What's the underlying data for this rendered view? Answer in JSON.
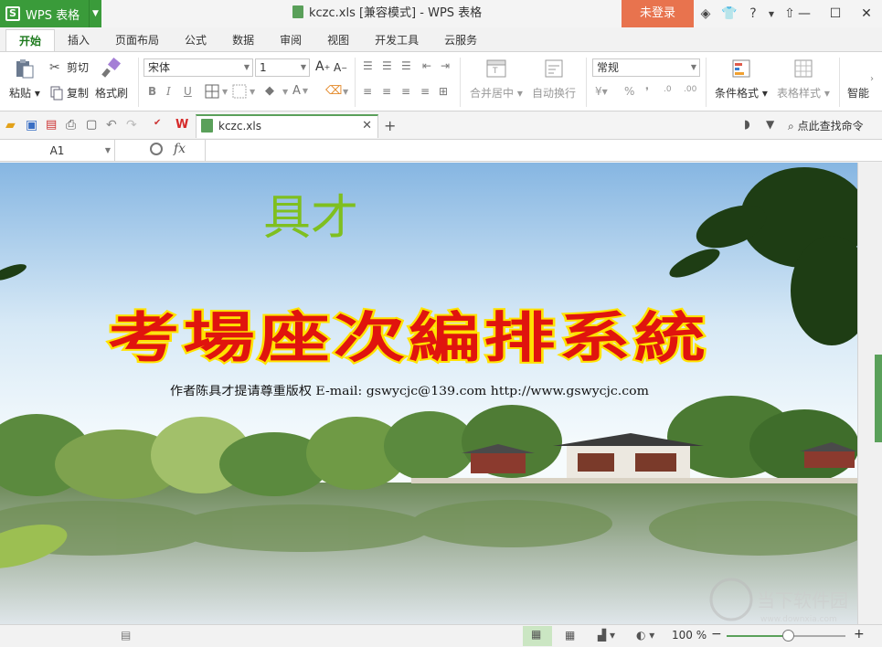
{
  "app": {
    "button_label": "WPS 表格",
    "logo_letter": "S",
    "document_title": "kczc.xls [兼容模式] - WPS 表格",
    "login_label": "未登录"
  },
  "menu_tabs": [
    "开始",
    "插入",
    "页面布局",
    "公式",
    "数据",
    "审阅",
    "视图",
    "开发工具",
    "云服务"
  ],
  "ribbon": {
    "paste": "粘贴",
    "cut": "剪切",
    "copy": "复制",
    "format_painter": "格式刷",
    "font_name": "宋体",
    "font_size": "1",
    "bold": "B",
    "italic": "I",
    "underline": "U",
    "merge_center": "合并居中",
    "wrap_text": "自动换行",
    "number_format": "常规",
    "percent": "%",
    "comma": "❜",
    "conditional_format": "条件格式",
    "table_style": "表格样式",
    "smart": "智能"
  },
  "tab": {
    "file_name": "kczc.xls"
  },
  "find_command": "点此查找命令",
  "formula_bar": {
    "cell_ref": "A1",
    "fx_label": "fx",
    "value": ""
  },
  "banner": {
    "author_name": "具才",
    "main_title": "考場座次編排系統",
    "credit": "作者陈具才提请尊重版权   E-mail: gswycjc@139.com     http://www.gswycjc.com"
  },
  "status_bar": {
    "zoom": "100 %",
    "minus": "−",
    "plus": "+",
    "zoom_fraction": 0.52
  },
  "watermark": {
    "text": "当下软件园",
    "url": "www.downxia.com"
  },
  "colors": {
    "brand_green": "#3a9b3a",
    "login_orange": "#e8734e",
    "title_red": "#e0140e",
    "title_yellow": "#ffe200",
    "author_green": "#7fbf1f"
  }
}
